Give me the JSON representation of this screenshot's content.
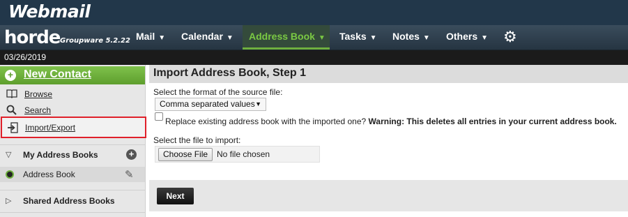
{
  "header": {
    "brand": "Webmail"
  },
  "nav": {
    "logo": "horde",
    "product": "Groupware 5.2.22",
    "items": [
      {
        "label": "Mail",
        "active": false
      },
      {
        "label": "Calendar",
        "active": false
      },
      {
        "label": "Address Book",
        "active": true
      },
      {
        "label": "Tasks",
        "active": false
      },
      {
        "label": "Notes",
        "active": false
      },
      {
        "label": "Others",
        "active": false
      }
    ],
    "settings_icon": "gear-icon"
  },
  "date": "03/26/2019",
  "sidebar": {
    "new_contact": "New Contact",
    "links": [
      {
        "label": "Browse",
        "icon": "book-icon"
      },
      {
        "label": "Search",
        "icon": "search-icon"
      },
      {
        "label": "Import/Export",
        "icon": "import-export-icon"
      }
    ],
    "my_address_books": "My Address Books",
    "address_book": "Address Book",
    "shared_address_books": "Shared Address Books"
  },
  "main": {
    "title": "Import Address Book, Step 1",
    "format_label": "Select the format of the source file:",
    "format_value": "Comma separated values",
    "replace_text": "Replace existing address book with the imported one?",
    "replace_warning": "Warning: This deletes all entries in your current address book.",
    "file_label": "Select the file to import:",
    "choose_file": "Choose File",
    "file_status": "No file chosen",
    "next": "Next"
  },
  "colors": {
    "accent_green": "#6fb03f",
    "highlight_red": "#e0202a",
    "nav_bg": "#2f3f4d"
  }
}
